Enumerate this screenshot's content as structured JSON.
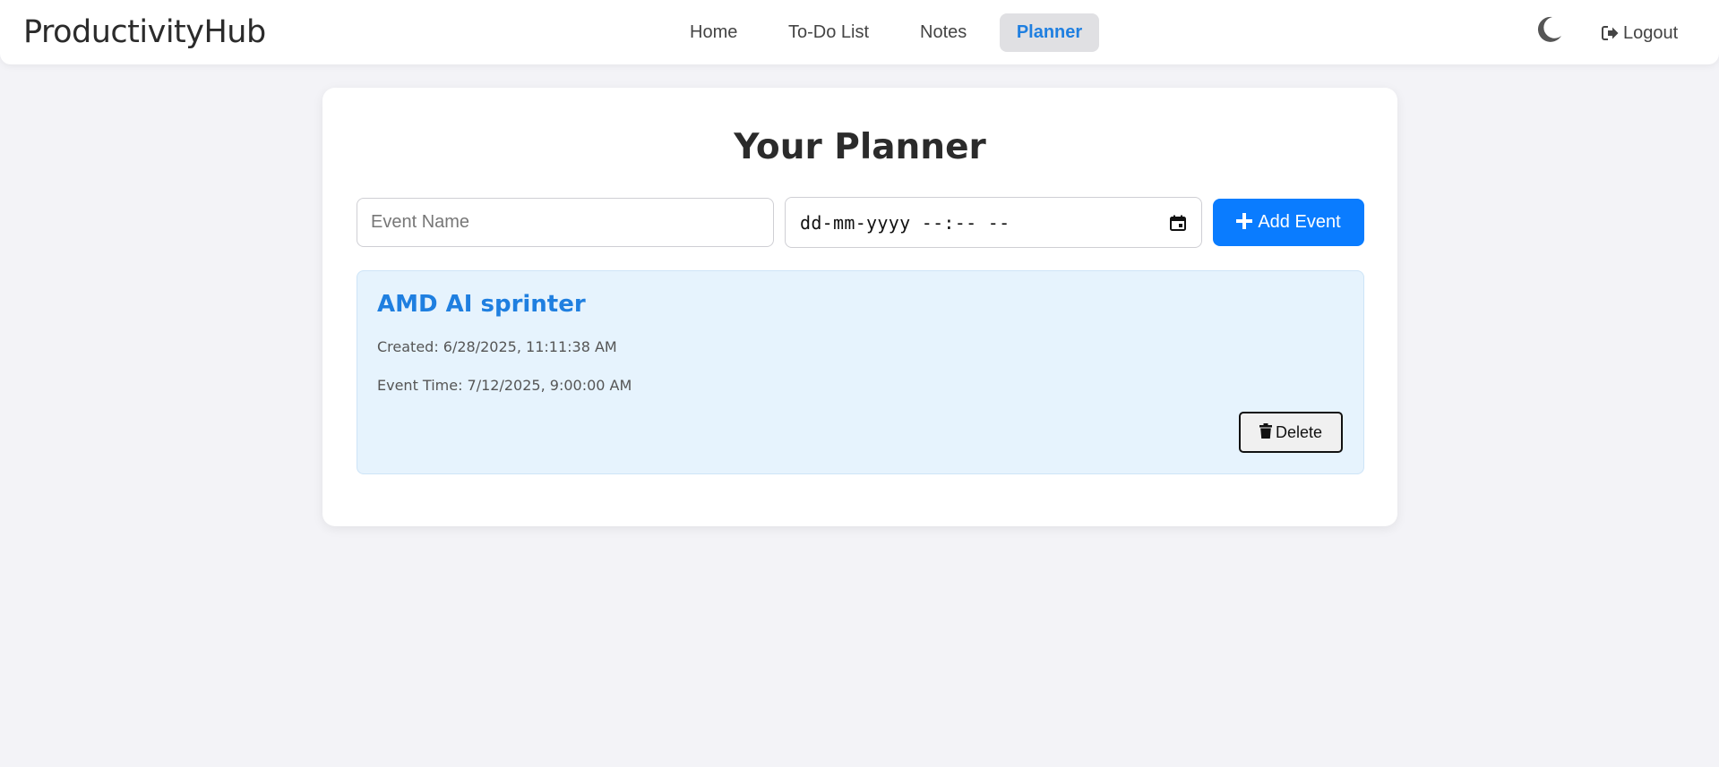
{
  "app": {
    "brand": "ProductivityHub"
  },
  "nav": {
    "items": [
      {
        "label": "Home",
        "active": false
      },
      {
        "label": "To-Do List",
        "active": false
      },
      {
        "label": "Notes",
        "active": false
      },
      {
        "label": "Planner",
        "active": true
      }
    ],
    "theme_toggle_icon": "moon-icon",
    "logout_label": "Logout",
    "logout_icon": "sign-out-icon"
  },
  "planner": {
    "title": "Your Planner",
    "event_name_placeholder": "Event Name",
    "event_name_value": "",
    "datetime_placeholder": "dd-mm-yyyy --:-- --",
    "add_button_label": "Add Event",
    "add_button_icon": "plus-icon"
  },
  "events": [
    {
      "name": "AMD AI sprinter",
      "created": "Created: 6/28/2025, 11:11:38 AM",
      "event_time": "Event Time: 7/12/2025, 9:00:00 AM",
      "delete_label": "Delete",
      "delete_icon": "trash-icon"
    }
  ],
  "colors": {
    "accent": "#0a7cff",
    "active_nav_text": "#1f7fe0",
    "event_background": "#e6f3fd",
    "page_background": "#f3f3f7"
  }
}
